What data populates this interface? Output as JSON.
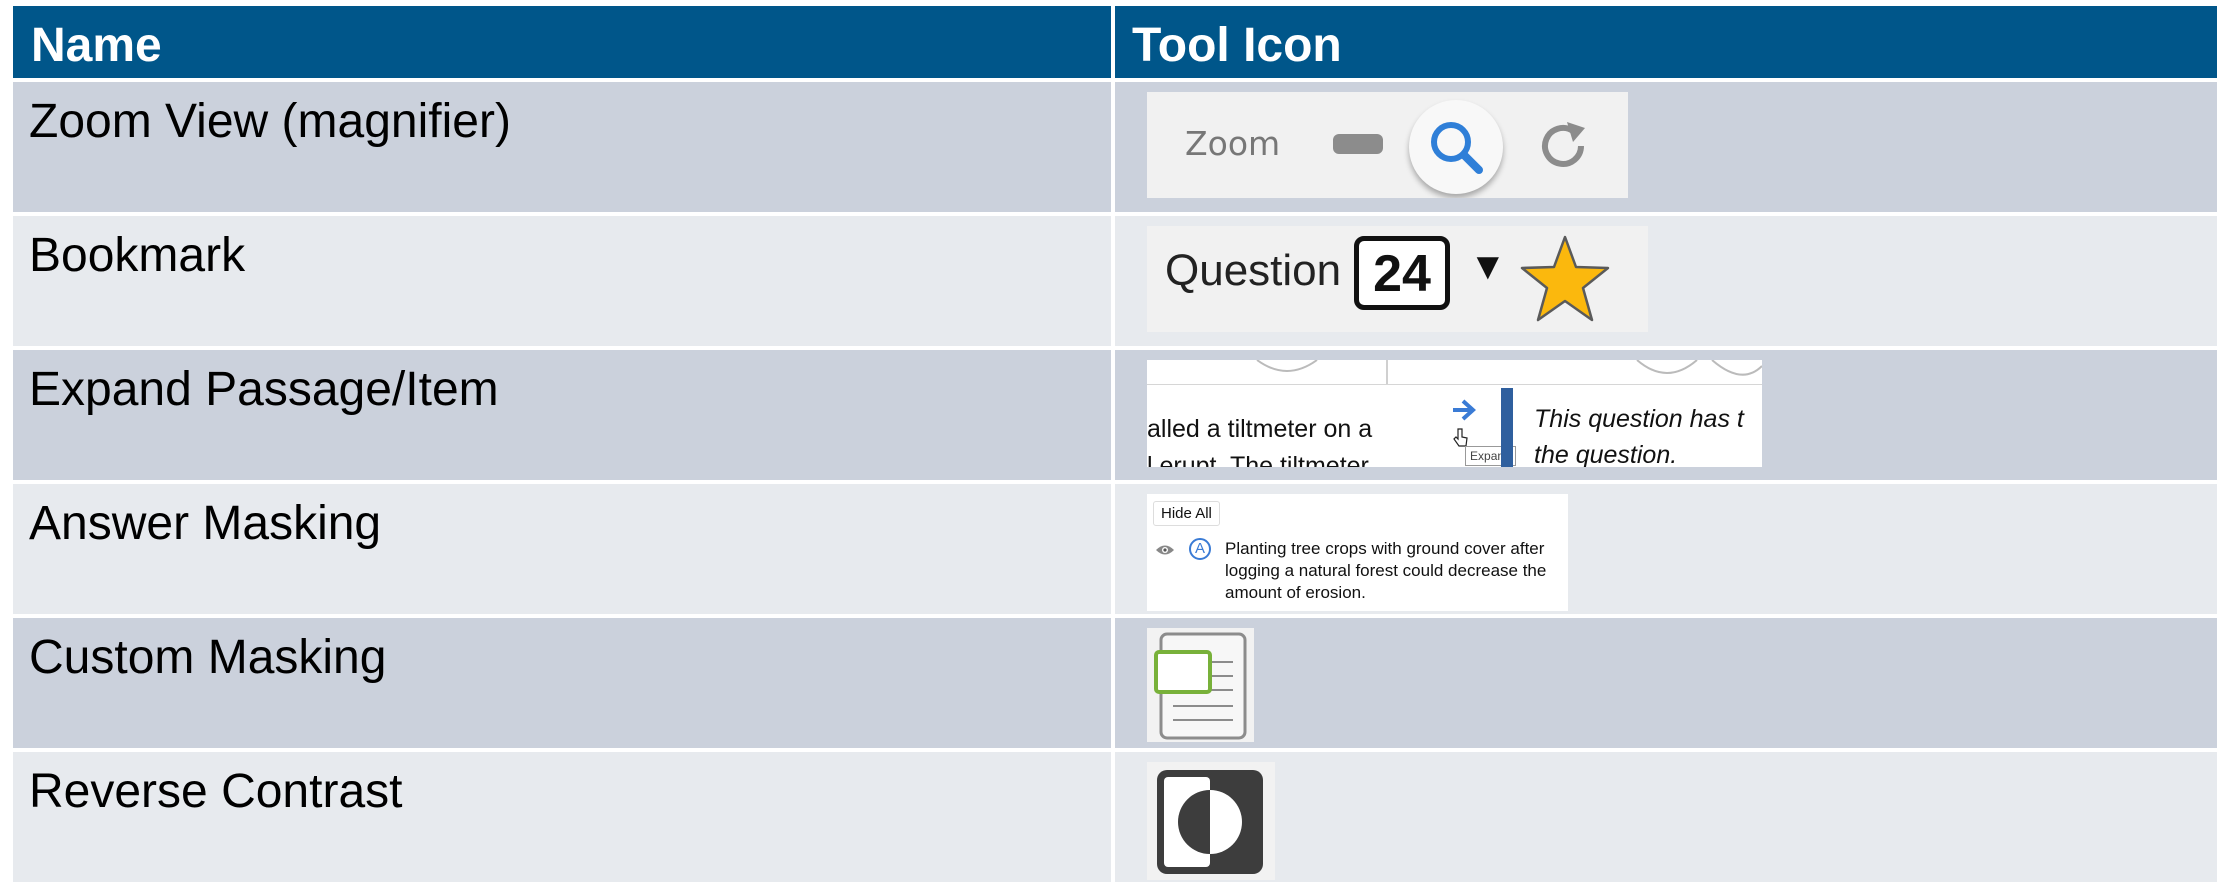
{
  "table": {
    "headers": {
      "name": "Name",
      "icon": "Tool Icon"
    },
    "rows": [
      {
        "name": "Zoom View (magnifier)",
        "icon": "zoom-toolbar-icon"
      },
      {
        "name": "Bookmark",
        "icon": "bookmark-star-icon"
      },
      {
        "name": "Expand Passage/Item",
        "icon": "expand-arrow-icon"
      },
      {
        "name": "Answer Masking",
        "icon": "answer-mask-eye-icon"
      },
      {
        "name": "Custom Masking",
        "icon": "custom-mask-icon"
      },
      {
        "name": "Reverse Contrast",
        "icon": "reverse-contrast-icon"
      }
    ]
  },
  "zoom": {
    "label": "Zoom"
  },
  "bookmark": {
    "label": "Question",
    "number": "24",
    "star_color": "#fbb80d"
  },
  "expand": {
    "passage_line1": "alled a tiltmeter on a",
    "passage_line2": "l erupt. The tiltmeter",
    "question_line1": "This question has t",
    "question_line2": "the question.",
    "tooltip": "Expand"
  },
  "answer_masking": {
    "hide_all": "Hide All",
    "option_letter": "A",
    "option_text": "Planting tree crops with ground cover after logging a natural forest could decrease the amount of erosion."
  },
  "colors": {
    "header_bg": "#00568a",
    "row_odd": "#cbd1dc",
    "row_even": "#e7eaee",
    "accent_blue": "#2f7fd8",
    "mask_green": "#78b13a"
  }
}
